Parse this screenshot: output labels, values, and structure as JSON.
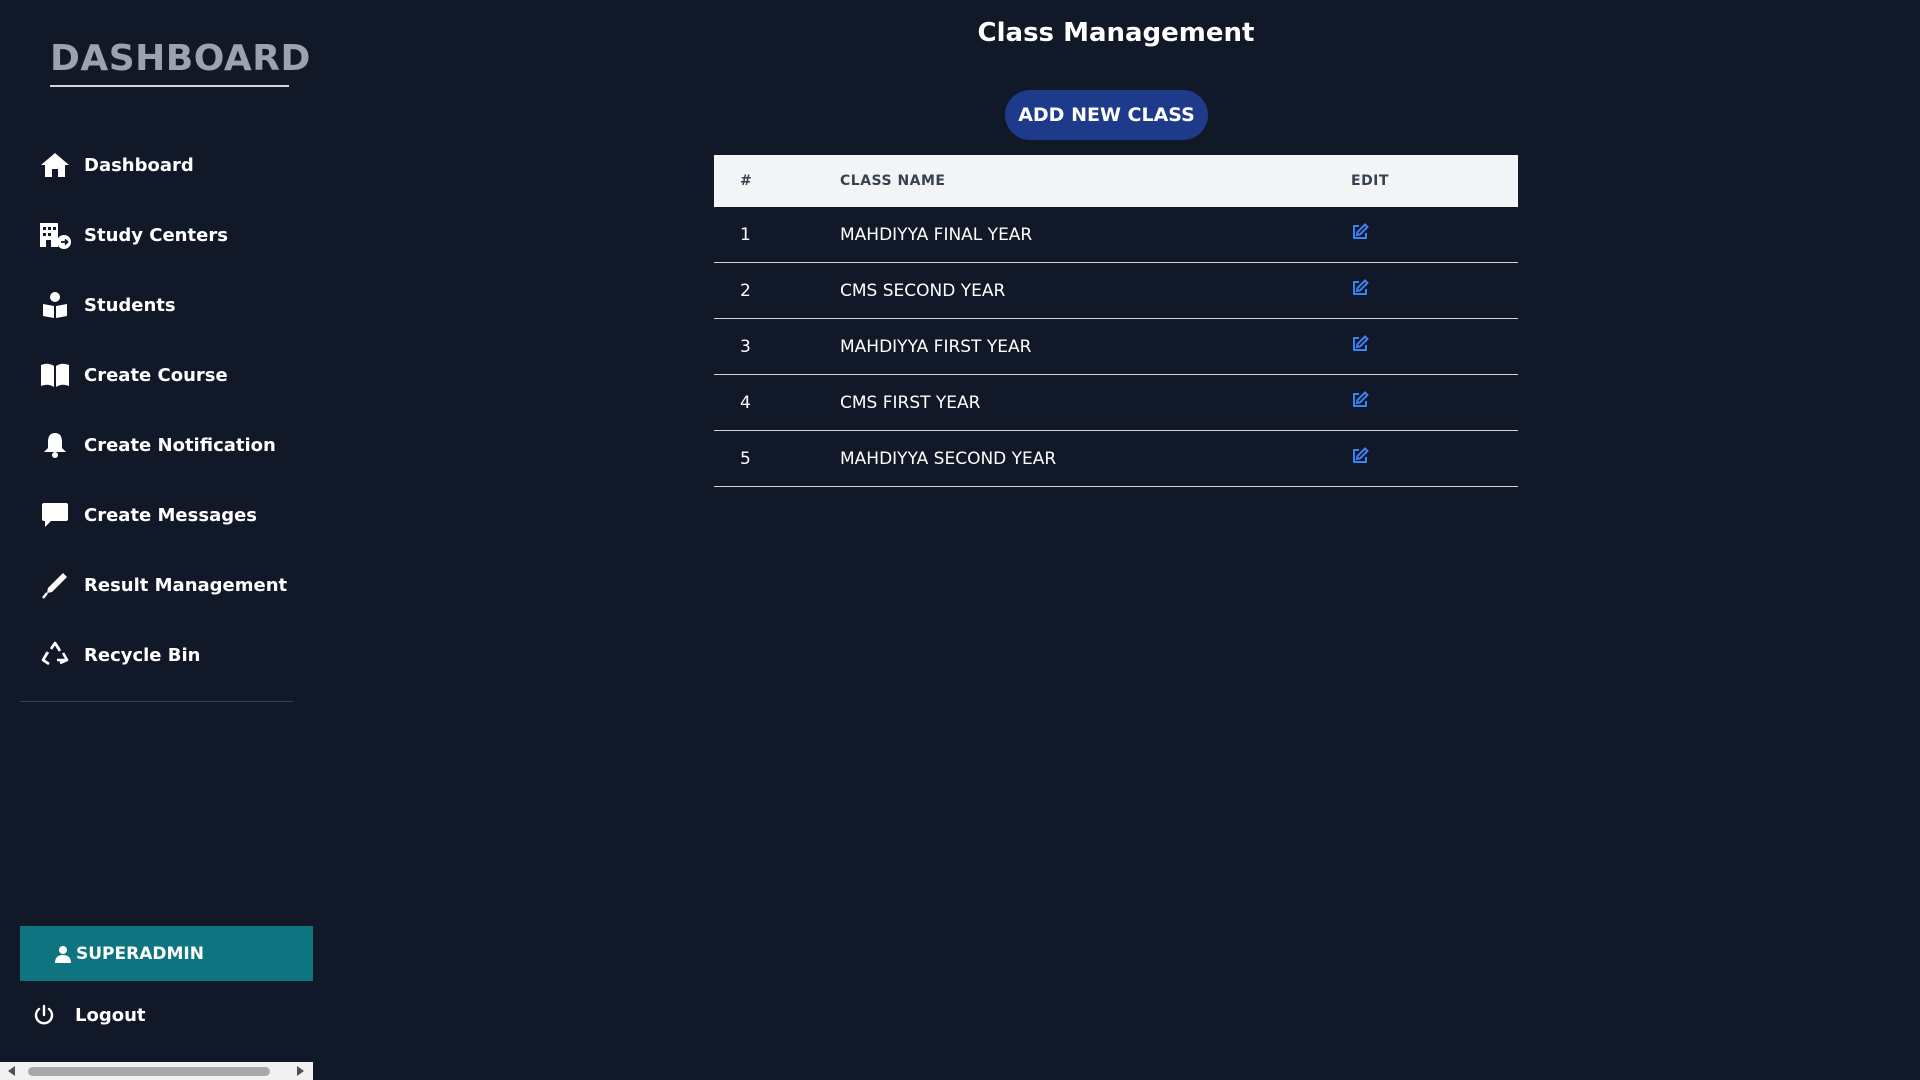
{
  "sidebar": {
    "brand": "DASHBOARD",
    "items": [
      {
        "label": "Dashboard",
        "icon": "home-icon"
      },
      {
        "label": "Study Centers",
        "icon": "building-icon"
      },
      {
        "label": "Students",
        "icon": "student-icon"
      },
      {
        "label": "Create Course",
        "icon": "book-icon"
      },
      {
        "label": "Create Notification",
        "icon": "bell-icon"
      },
      {
        "label": "Create Messages",
        "icon": "message-icon"
      },
      {
        "label": "Result Management",
        "icon": "pen-icon"
      },
      {
        "label": "Recycle Bin",
        "icon": "recycle-icon"
      }
    ],
    "user_label": "SUPERADMIN",
    "logout_label": "Logout"
  },
  "main": {
    "title": "Class Management",
    "add_button_label": "ADD NEW CLASS",
    "table": {
      "headers": [
        "#",
        "CLASS NAME",
        "EDIT"
      ],
      "rows": [
        {
          "num": "1",
          "name": "MAHDIYYA FINAL YEAR"
        },
        {
          "num": "2",
          "name": "CMS SECOND YEAR"
        },
        {
          "num": "3",
          "name": "MAHDIYYA FIRST YEAR"
        },
        {
          "num": "4",
          "name": "CMS FIRST YEAR"
        },
        {
          "num": "5",
          "name": "MAHDIYYA SECOND YEAR"
        }
      ]
    }
  },
  "colors": {
    "background": "#111827",
    "user_button": "#0e7480",
    "add_button": "#1e3a8a",
    "edit_icon": "#3b82f6"
  }
}
